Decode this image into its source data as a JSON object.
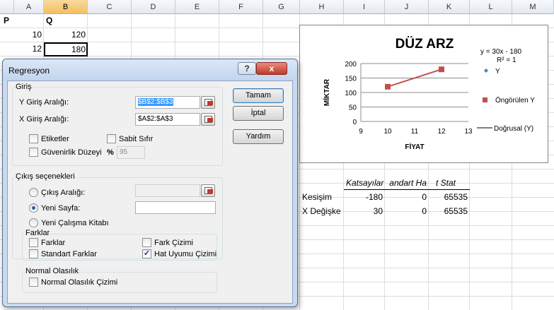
{
  "sheet": {
    "columns": [
      "A",
      "B",
      "C",
      "D",
      "E",
      "F",
      "G",
      "H",
      "I",
      "J",
      "K",
      "L",
      "M"
    ],
    "cells": {
      "a1": "P",
      "b1": "Q",
      "a2": "10",
      "b2": "120",
      "a3": "12",
      "b3": "180"
    },
    "output": {
      "headers": [
        "Katsayılar",
        "andart Ha",
        "t Stat"
      ],
      "rows": [
        {
          "label": "Kesişim",
          "values": [
            "-180",
            "0",
            "65535"
          ]
        },
        {
          "label": "X Değişke",
          "values": [
            "30",
            "0",
            "65535"
          ]
        }
      ]
    }
  },
  "chart": {
    "title": "DÜZ ARZ",
    "xlabel": "FİYAT",
    "ylabel": "MİKTAR",
    "equation": "y = 30x - 180",
    "r2": "R² = 1",
    "legend": [
      "Y",
      "Öngörülen Y",
      "Doğrusal (Y)"
    ],
    "xticks": [
      "9",
      "10",
      "11",
      "12",
      "13"
    ],
    "yticks": [
      "0",
      "50",
      "100",
      "150",
      "200"
    ]
  },
  "chart_data": {
    "type": "scatter",
    "title": "DÜZ ARZ",
    "xlabel": "FİYAT",
    "ylabel": "MİKTAR",
    "xlim": [
      9,
      13
    ],
    "ylim": [
      0,
      200
    ],
    "grid": true,
    "legend_position": "right",
    "series": [
      {
        "name": "Y",
        "x": [
          10,
          12
        ],
        "y": [
          120,
          180
        ],
        "color": "#4f81bd",
        "marker": "diamond"
      },
      {
        "name": "Öngörülen Y",
        "x": [
          10,
          12
        ],
        "y": [
          120,
          180
        ],
        "color": "#c0504d",
        "marker": "square"
      },
      {
        "name": "Doğrusal (Y)",
        "x": [
          10,
          12
        ],
        "y": [
          120,
          180
        ],
        "color": "#c0504d",
        "marker": "line"
      }
    ],
    "annotations": [
      "y = 30x - 180",
      "R² = 1"
    ]
  },
  "dialog": {
    "title": "Regresyon",
    "help": "?",
    "close": "x",
    "input_group": "Giriş",
    "y_range_label": "Y Giriş Aralığı:",
    "y_range_value": "$B$2:$B$3",
    "x_range_label": "X Giriş Aralığı:",
    "x_range_value": "$A$2:$A$3",
    "labels_cb": "Etiketler",
    "constant_zero_cb": "Sabit Sıfır",
    "confidence_cb": "Güvenirlik Düzeyi",
    "confidence_pct": "%",
    "confidence_value": "95",
    "ok": "Tamam",
    "cancel": "İptal",
    "help_btn": "Yardım",
    "output_group": "Çıkış seçenekleri",
    "output_range": "Çıkış Aralığı:",
    "new_sheet": "Yeni Sayfa:",
    "new_workbook": "Yeni Çalışma Kitabı",
    "residuals_group": "Farklar",
    "residuals": "Farklar",
    "std_residuals": "Standart Farklar",
    "residual_plots": "Fark Çizimi",
    "line_fit_plots": "Hat Uyumu Çizimi",
    "normal_group": "Normal Olasılık",
    "normal_plots": "Normal Olasılık Çizimi",
    "states": {
      "labels": false,
      "constant_zero": false,
      "confidence": false,
      "output_range": false,
      "new_sheet": true,
      "new_workbook": false,
      "residuals": false,
      "std_residuals": false,
      "residual_plots": false,
      "line_fit_plots": true,
      "normal_plots": false
    },
    "check_mark": "✓"
  }
}
